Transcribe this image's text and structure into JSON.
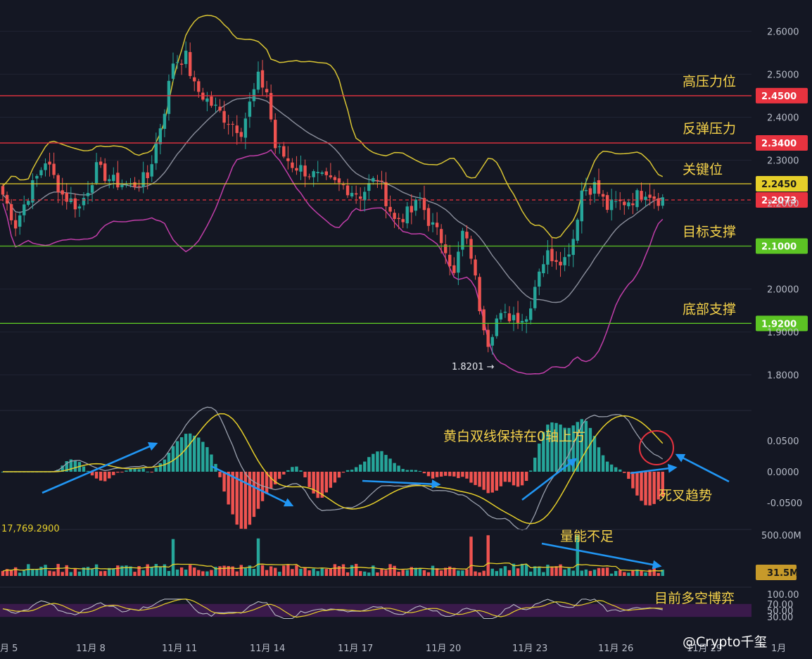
{
  "chart_data": {
    "type": "candlestick",
    "price_axis": {
      "ticks": [
        "2.6000",
        "2.5000",
        "2.4000",
        "2.3000",
        "2.2000",
        "2.0000",
        "1.9000",
        "1.8000"
      ],
      "range": [
        1.755,
        2.64
      ]
    },
    "x_axis": {
      "ticks": [
        "月 5",
        "11月 8",
        "11月 11",
        "11月 14",
        "11月 17",
        "11月 20",
        "11月 23",
        "11月 26",
        "11月 29",
        "1月"
      ]
    },
    "levels": [
      {
        "value": "2.4500",
        "price": 2.45,
        "label": "高压力位",
        "color": "#e8333f",
        "style": "solid"
      },
      {
        "value": "2.3400",
        "price": 2.34,
        "label": "反弹压力",
        "color": "#e8333f",
        "style": "solid"
      },
      {
        "value": "2.2450",
        "price": 2.245,
        "label": "关键位",
        "color": "#e6cf2a",
        "style": "solid"
      },
      {
        "value": "2.2073",
        "price": 2.2073,
        "label": "",
        "color": "#e8333f",
        "style": "dashed"
      },
      {
        "value": "2.1000",
        "price": 2.1,
        "label": "目标支撑",
        "color": "#5cc424",
        "style": "solid"
      },
      {
        "value": "1.9200",
        "price": 1.92,
        "label": "底部支撑",
        "color": "#5cc424",
        "style": "solid"
      }
    ],
    "low_marker": {
      "text": "1.8201 →",
      "price": 1.8201
    },
    "bollinger_colors": {
      "upper": "#d8c433",
      "middle": "#8b8f9c",
      "lower": "#c13ea9"
    },
    "macd": {
      "ticks": [
        "0.0500",
        "0.0000",
        "-0.0500"
      ],
      "range": [
        -0.085,
        0.085
      ],
      "label_left": "17,769.2900",
      "annotation_top": "黄白双线保持在0轴上方",
      "annotation_right": "死叉趋势"
    },
    "volume": {
      "ticks": [
        "500.00M"
      ],
      "current": "31.5M",
      "annotation": "量能不足"
    },
    "rsi": {
      "ticks": [
        "100.00",
        "70.00",
        "50.00",
        "30.00"
      ],
      "annotation": "目前多空博弈"
    },
    "watermark": "@Crypto千玺",
    "colors": {
      "up": "#26a69a",
      "down": "#ef5350",
      "background": "#141723",
      "arrow": "#2196f3"
    }
  }
}
